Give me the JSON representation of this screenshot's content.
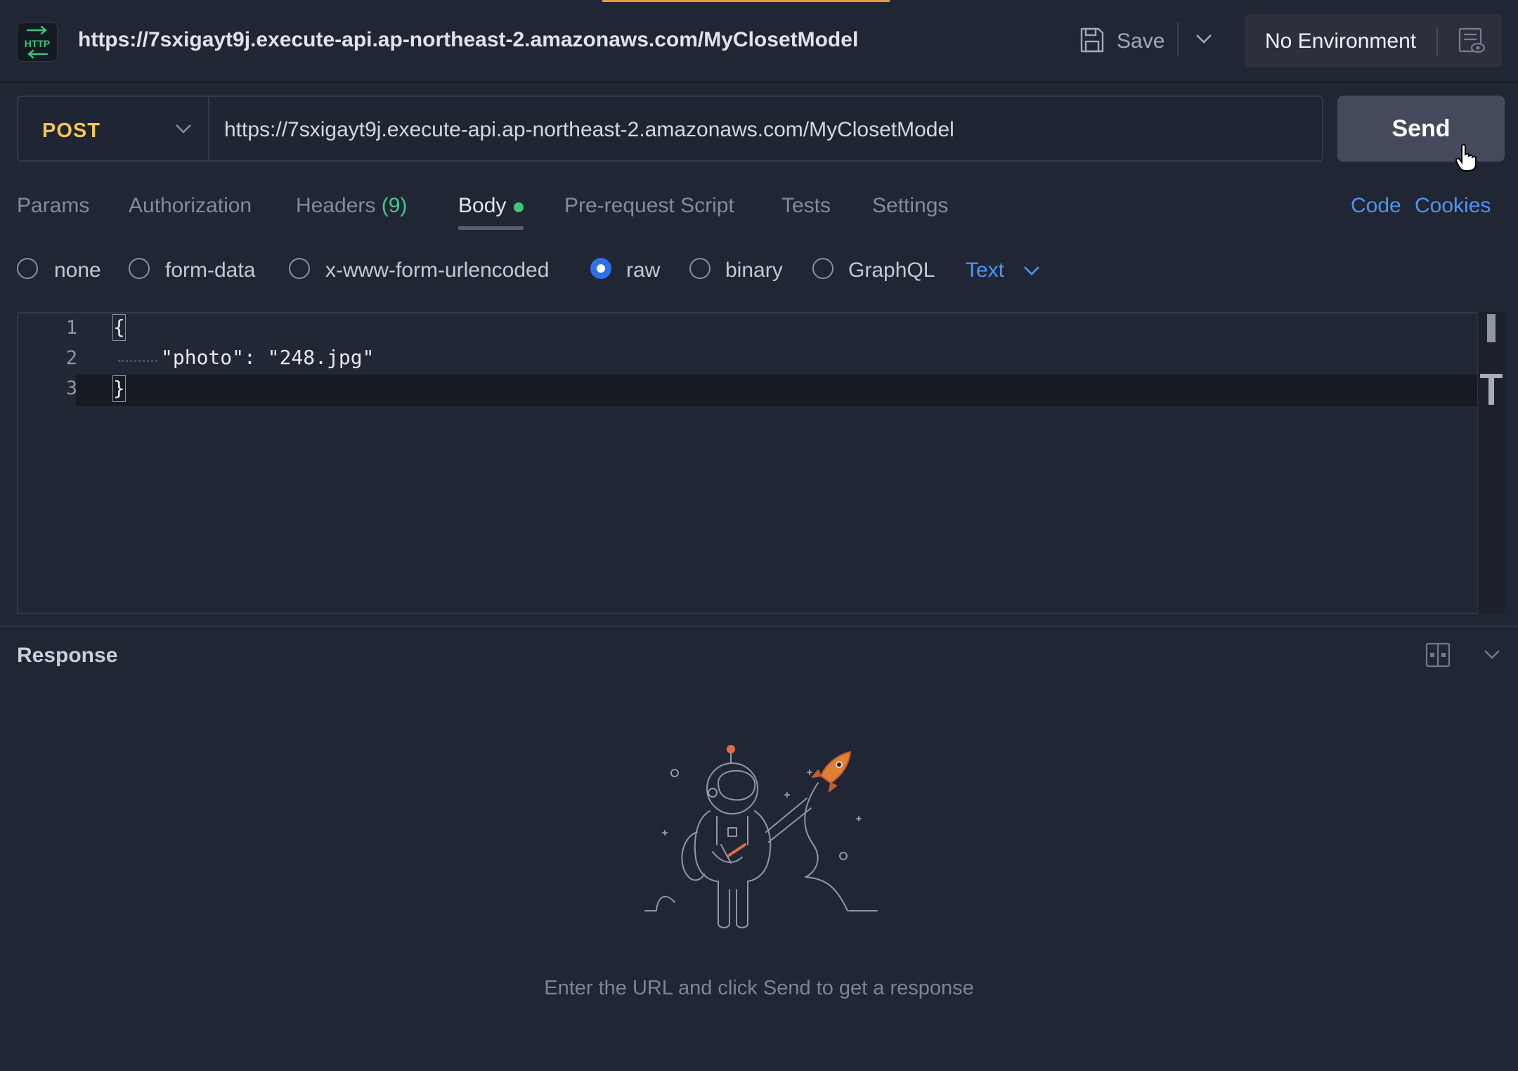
{
  "header": {
    "tab_icon_text": "HTTP",
    "tab_url": "https://7sxigayt9j.execute-api.ap-northeast-2.amazonaws.com/MyClosetModel",
    "save_label": "Save",
    "environment_label": "No Environment"
  },
  "request": {
    "method": "POST",
    "url": "https://7sxigayt9j.execute-api.ap-northeast-2.amazonaws.com/MyClosetModel",
    "send_label": "Send"
  },
  "tabs": {
    "params": "Params",
    "authorization": "Authorization",
    "headers": "Headers",
    "headers_count": "(9)",
    "body": "Body",
    "pre_request": "Pre-request Script",
    "tests": "Tests",
    "settings": "Settings",
    "active": "Body"
  },
  "links": {
    "code": "Code",
    "cookies": "Cookies"
  },
  "body_types": {
    "options": [
      "none",
      "form-data",
      "x-www-form-urlencoded",
      "raw",
      "binary",
      "GraphQL"
    ],
    "selected": "raw",
    "raw_format": "Text"
  },
  "editor": {
    "lines": [
      {
        "number": "1",
        "text": "{"
      },
      {
        "number": "2",
        "text": "\"photo\": \"248.jpg\""
      },
      {
        "number": "3",
        "text": "}"
      }
    ]
  },
  "response": {
    "title": "Response",
    "empty_hint": "Enter the URL and click Send to get a response"
  },
  "colors": {
    "background": "#212634",
    "method": "#f2c555",
    "link": "#4f95f2",
    "radio_selected": "#2b72e8",
    "status_dot": "#3ec57d",
    "send_button": "#44495c",
    "accent_bar": "#e59a3a"
  },
  "icons": [
    "http-icon",
    "save-icon",
    "chevron-down-icon",
    "environment-eye-icon",
    "cursor-hand-icon",
    "layout-split-icon",
    "astronaut-rocket-illustration"
  ]
}
